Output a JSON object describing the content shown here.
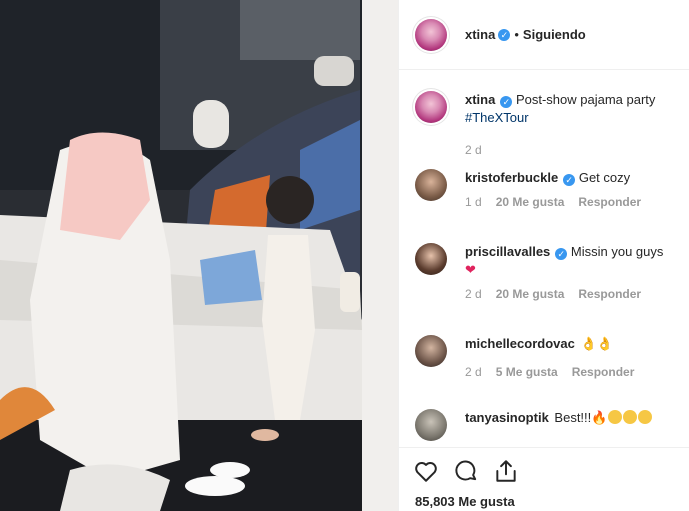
{
  "post": {
    "author": "xtina",
    "follow_status": "Siguiendo",
    "separator": "•",
    "caption_text": "Post-show pajama party",
    "caption_hashtag": "#TheXTour",
    "caption_time": "2 d"
  },
  "comments": [
    {
      "username": "kristoferbuckle",
      "verified": true,
      "text": "Get cozy",
      "time": "1 d",
      "likes": "20 Me gusta",
      "reply": "Responder"
    },
    {
      "username": "priscillavalles",
      "verified": true,
      "text": "Missin you guys",
      "emoji": "heart",
      "time": "2 d",
      "likes": "20 Me gusta",
      "reply": "Responder"
    },
    {
      "username": "michellecordovac",
      "verified": false,
      "text": "",
      "emoji": "ok-hands",
      "time": "2 d",
      "likes": "5 Me gusta",
      "reply": "Responder"
    },
    {
      "username": "tanyasinoptik",
      "verified": false,
      "text": "Best!!!",
      "emoji": "fire-and-heart-eyes"
    }
  ],
  "footer": {
    "likes_text": "85,803 Me gusta"
  },
  "icons": {
    "like": "heart-icon",
    "comment": "comment-icon",
    "share": "share-icon",
    "verified": "verified-badge-icon"
  },
  "colors": {
    "verified": "#3897f0",
    "hashtag": "#003569",
    "meta": "#999999",
    "border": "#efefef"
  }
}
